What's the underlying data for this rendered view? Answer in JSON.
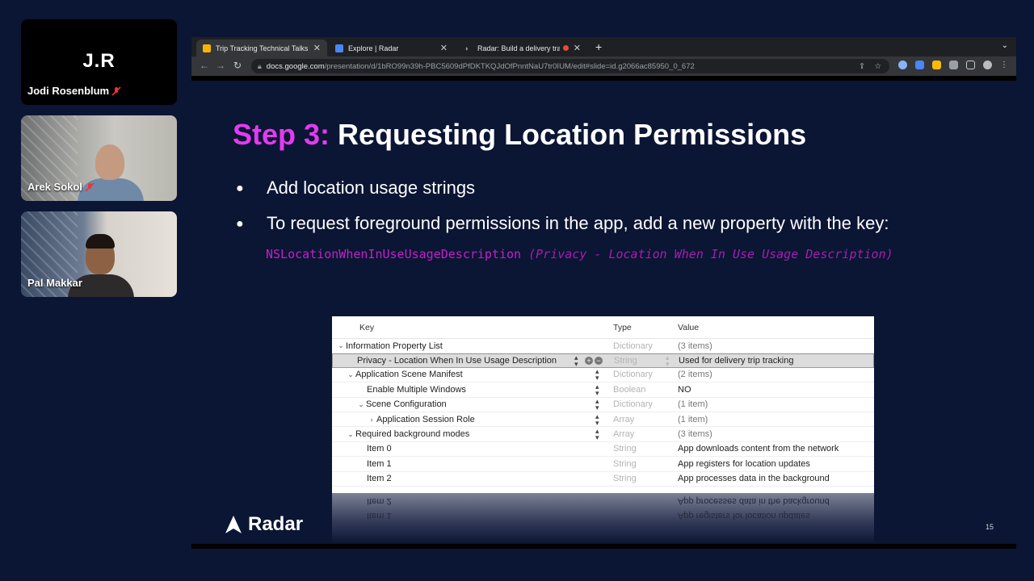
{
  "participants": [
    {
      "initials": "J.R",
      "name": "Jodi Rosenblum",
      "muted": true
    },
    {
      "initials": "",
      "name": "Arek Sokol",
      "muted": true
    },
    {
      "initials": "",
      "name": "Pal Makkar",
      "muted": false
    }
  ],
  "browser": {
    "tabs": [
      {
        "label": "Trip Tracking Technical Talks - ",
        "favicon_color": "#f4b400",
        "active": true
      },
      {
        "label": "Explore | Radar",
        "favicon_color": "#4a86f4",
        "active": false
      },
      {
        "label": "Radar: Build a delivery trac",
        "favicon_color": "#9a9aa0",
        "active": false
      }
    ],
    "url_host": "docs.google.com",
    "url_path": "/presentation/d/1bRO99n39h-PBC5609dPfDKTKQJdOfPnntNaU7tr0IUM/edit#slide=id.g2066ac85950_0_672"
  },
  "slide": {
    "step": "Step 3:",
    "title": "Requesting Location Permissions",
    "bullets": [
      "Add location usage strings",
      "To request foreground permissions in the app, add a new property with the key:"
    ],
    "code_key": "NSLocationWhenInUseUsageDescription",
    "code_desc": "(Privacy - Location When In Use Usage Description)",
    "plist": {
      "headers": {
        "key": "Key",
        "type": "Type",
        "value": "Value"
      },
      "rows": [
        {
          "key": "Information Property List",
          "type": "Dictionary",
          "value": "(3 items)"
        },
        {
          "key": "Privacy - Location When In Use Usage Description",
          "type": "String",
          "value": "Used for delivery trip tracking"
        },
        {
          "key": "Application Scene Manifest",
          "type": "Dictionary",
          "value": "(2 items)"
        },
        {
          "key": "Enable Multiple Windows",
          "type": "Boolean",
          "value": "NO"
        },
        {
          "key": "Scene Configuration",
          "type": "Dictionary",
          "value": "(1 item)"
        },
        {
          "key": "Application Session Role",
          "type": "Array",
          "value": "(1 item)"
        },
        {
          "key": "Required background modes",
          "type": "Array",
          "value": "(3 items)"
        },
        {
          "key": "Item 0",
          "type": "String",
          "value": "App downloads content from the network"
        },
        {
          "key": "Item 1",
          "type": "String",
          "value": "App registers for location updates"
        },
        {
          "key": "Item 2",
          "type": "String",
          "value": "App processes data in the background"
        }
      ]
    },
    "logo_text": "Radar",
    "page_number": "15"
  },
  "colors": {
    "background": "#0b1534",
    "step_accent": "#e23bf0",
    "code_color": "#c221c8"
  }
}
